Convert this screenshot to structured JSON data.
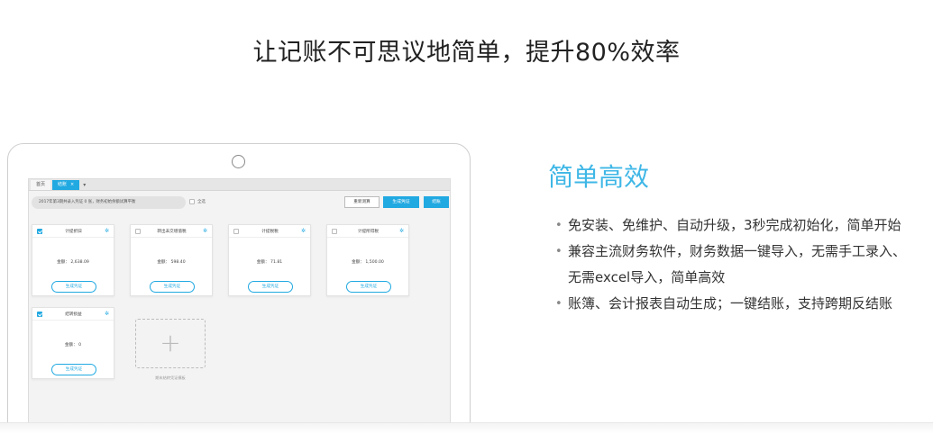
{
  "headline": "让记账不可思议地简单，提升80%效率",
  "app": {
    "tabs": [
      {
        "label": "首页",
        "active": false
      },
      {
        "label": "结账",
        "active": true,
        "close": "×"
      }
    ],
    "tab_add": "▾",
    "info_text": "2017年第3期共录入凭证 0 张，财务初始余额试算平衡",
    "select_all_label": "全选",
    "btn_recalc": "重新测算",
    "btn_generate": "生成凭证",
    "btn_close": "结账",
    "cards": [
      {
        "title": "计提折旧",
        "amount": "金额： 2,638.09",
        "button": "生成凭证",
        "checked": true
      },
      {
        "title": "转出未交增值税",
        "amount": "金额： 598.40",
        "button": "生成凭证",
        "checked": false
      },
      {
        "title": "计提税税",
        "amount": "金额： 71.81",
        "button": "生成凭证",
        "checked": false
      },
      {
        "title": "计提所得税",
        "amount": "金额： 1,500.00",
        "button": "生成凭证",
        "checked": false
      },
      {
        "title": "结转损益",
        "amount": "金额： 0",
        "button": "生成凭证",
        "checked": true
      }
    ],
    "add_icon": "+",
    "add_caption": "期末结转凭证模板"
  },
  "feature": {
    "title": "简单高效",
    "bullets": [
      {
        "line1": "免安装、免维护、自动升级，3秒完成初始化，简单开始",
        "line2": ""
      },
      {
        "line1": "兼容主流财务软件，财务数据一键导入，无需手工录入、",
        "line2": "无需excel导入，简单高效"
      },
      {
        "line1": "账簿、会计报表自动生成；一键结账，支持跨期反结账",
        "line2": ""
      }
    ]
  },
  "colors": {
    "accent": "#21a9e1",
    "title_blue": "#3fb7e6"
  },
  "icons": {
    "settings": "gear-icon",
    "checkbox": "checkbox-icon",
    "add": "plus-icon",
    "camera": "camera-dot"
  }
}
